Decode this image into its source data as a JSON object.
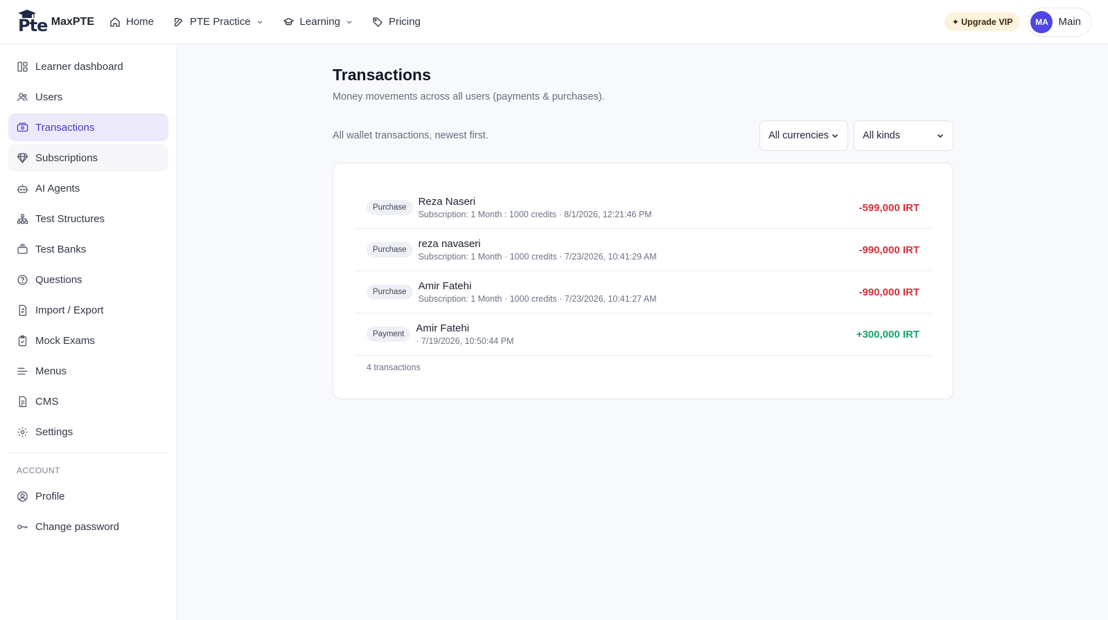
{
  "brand": {
    "logo_text": "Pte",
    "name": "MaxPTE"
  },
  "nav": [
    {
      "label": "Home",
      "icon": "home-icon",
      "dropdown": false
    },
    {
      "label": "PTE Practice",
      "icon": "edit-icon",
      "dropdown": true
    },
    {
      "label": "Learning",
      "icon": "graduation-cap-icon",
      "dropdown": true
    },
    {
      "label": "Pricing",
      "icon": "tag-icon",
      "dropdown": false
    }
  ],
  "header": {
    "vip_label": "Upgrade VIP",
    "user": {
      "initials": "MA",
      "name": "Main"
    }
  },
  "sidebar": {
    "items": [
      {
        "label": "Learner dashboard",
        "icon": "dashboard-icon"
      },
      {
        "label": "Users",
        "icon": "users-icon"
      },
      {
        "label": "Transactions",
        "icon": "banknote-icon",
        "active": true
      },
      {
        "label": "Subscriptions",
        "icon": "gem-icon"
      },
      {
        "label": "AI Agents",
        "icon": "bot-icon"
      },
      {
        "label": "Test Structures",
        "icon": "sitemap-icon"
      },
      {
        "label": "Test Banks",
        "icon": "archive-icon"
      },
      {
        "label": "Questions",
        "icon": "help-circle-icon"
      },
      {
        "label": "Import / Export",
        "icon": "file-transfer-icon"
      },
      {
        "label": "Mock Exams",
        "icon": "clipboard-check-icon"
      },
      {
        "label": "Menus",
        "icon": "menu-lines-icon"
      },
      {
        "label": "CMS",
        "icon": "file-text-icon"
      },
      {
        "label": "Settings",
        "icon": "gear-icon"
      }
    ],
    "account_section": "ACCOUNT",
    "account_items": [
      {
        "label": "Profile",
        "icon": "user-circle-icon"
      },
      {
        "label": "Change password",
        "icon": "key-icon"
      }
    ]
  },
  "page": {
    "title": "Transactions",
    "subtitle": "Money movements across all users (payments & purchases).",
    "list_description": "All wallet transactions, newest first.",
    "filters": {
      "currency": {
        "selected": "All currencies"
      },
      "kind": {
        "selected": "All kinds"
      }
    }
  },
  "transactions": [
    {
      "kind": "Purchase",
      "name": "Reza Naseri",
      "meta": "Subscription: 1 Month : 1000 credits · 8/1/2026, 12:21:46 PM",
      "amount": "-599,000 IRT",
      "direction": "out"
    },
    {
      "kind": "Purchase",
      "name": "reza navaseri",
      "meta": "Subscription: 1 Month · 1000 credits · 7/23/2026, 10:41:29 AM",
      "amount": "-990,000 IRT",
      "direction": "out"
    },
    {
      "kind": "Purchase",
      "name": "Amir Fatehi",
      "meta": "Subscription: 1 Month · 1000 credits · 7/23/2026, 10:41:27 AM",
      "amount": "-990,000 IRT",
      "direction": "out"
    },
    {
      "kind": "Payment",
      "name": "Amir Fatehi",
      "meta": "· 7/19/2026, 10:50:44 PM",
      "amount": "+300,000 IRT",
      "direction": "in"
    }
  ],
  "transactions_count": "4 transactions",
  "colors": {
    "accent": "#4f46e5",
    "active_bg": "#ece9fb",
    "negative": "#d62f3c",
    "positive": "#16a36a",
    "vip_bg": "#fdf2dc"
  }
}
